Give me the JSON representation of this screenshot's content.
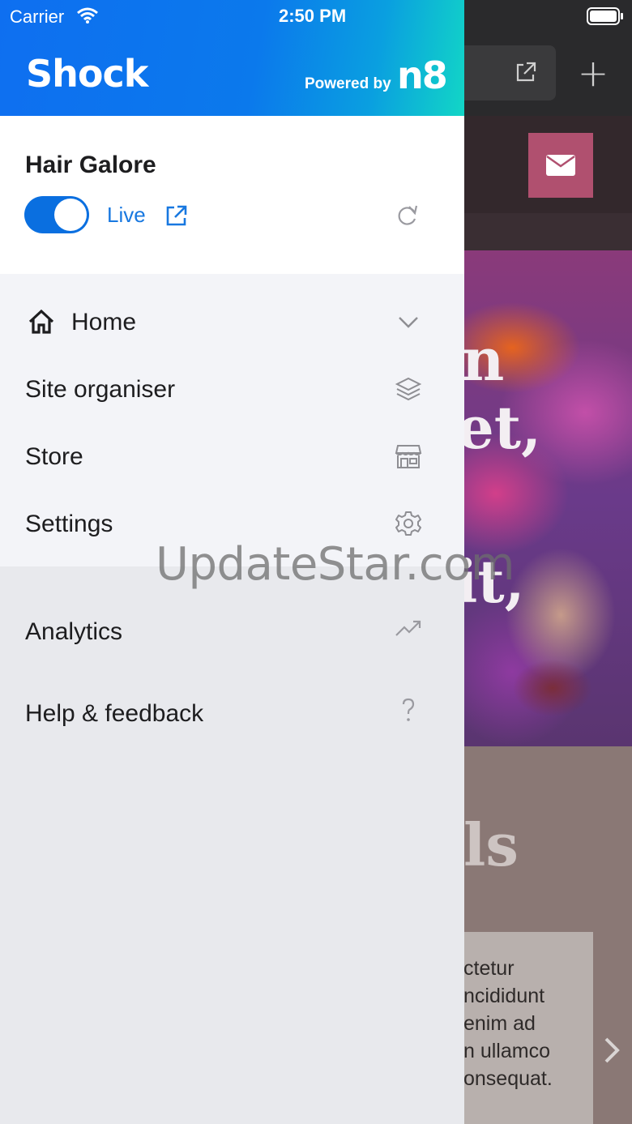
{
  "status_bar": {
    "carrier": "Carrier",
    "time": "2:50 PM"
  },
  "drawer": {
    "brand": "Shock",
    "powered_by": "Powered by",
    "powered_brand": "n8",
    "colors": {
      "header_start": "#0e6ff0",
      "header_end": "#12d6c6",
      "accent": "#0a6fe0"
    }
  },
  "site": {
    "name": "Hair Galore",
    "status_label": "Live",
    "live": true
  },
  "menu": {
    "home": "Home",
    "site_organiser": "Site organiser",
    "store": "Store",
    "settings": "Settings",
    "analytics": "Analytics",
    "help": "Help & feedback"
  },
  "background": {
    "hero_lines": [
      "n",
      "et,",
      "it,"
    ],
    "section_fragment": "ls",
    "lorem_lines": [
      "ctetur",
      "ncididunt",
      "enim ad",
      "n ullamco",
      "onsequat."
    ]
  },
  "watermark": "UpdateStar.com"
}
